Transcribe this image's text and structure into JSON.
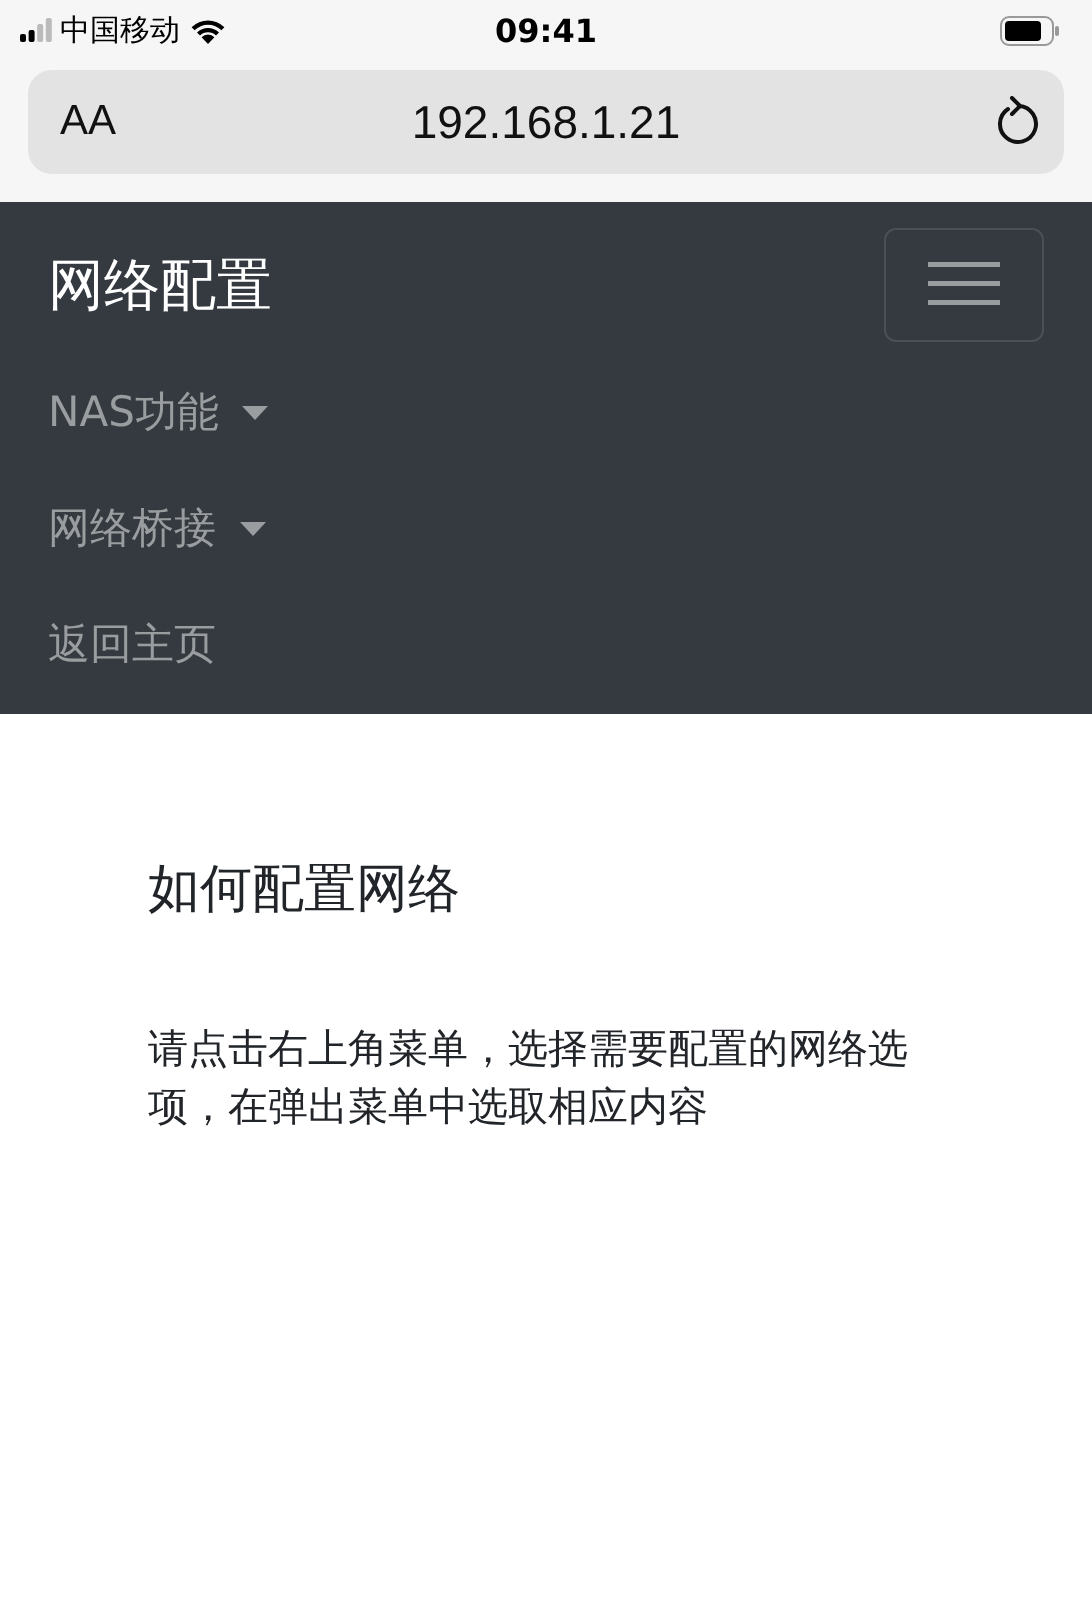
{
  "status_bar": {
    "carrier": "中国移动",
    "time": "09:41"
  },
  "address_bar": {
    "text_size": "AA",
    "url": "192.168.1.21"
  },
  "navbar": {
    "brand": "网络配置",
    "items": [
      {
        "label": "NAS功能",
        "kind": "dropdown"
      },
      {
        "label": "网络桥接",
        "kind": "dropdown"
      },
      {
        "label": "返回主页",
        "kind": "link"
      }
    ]
  },
  "content": {
    "heading": "如何配置网络",
    "paragraph": "请点击右上角菜单，选择需要配置的网络选项，在弹出菜单中选取相应内容"
  }
}
